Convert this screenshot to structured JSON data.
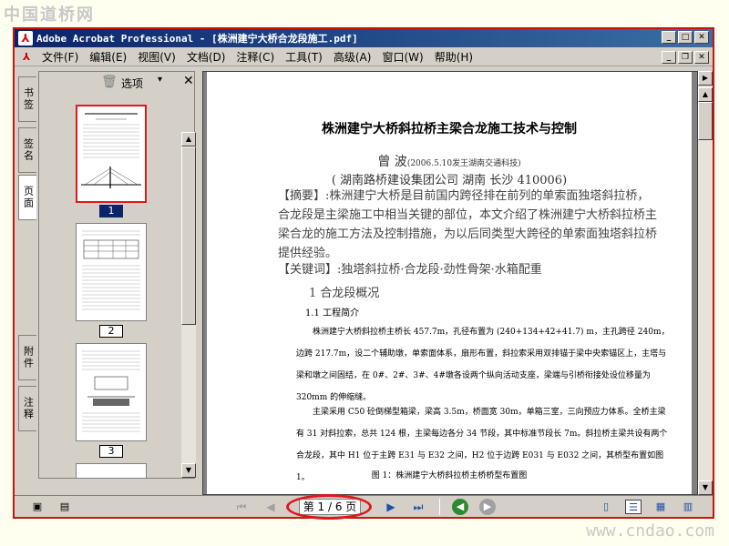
{
  "watermark_top": "中国道桥网",
  "watermark_bottom": "www.cndao.com",
  "window": {
    "title": "Adobe Acrobat Professional - [株洲建宁大桥合龙段施工.pdf]"
  },
  "menu": {
    "items": [
      "文件(F)",
      "编辑(E)",
      "视图(V)",
      "文档(D)",
      "注释(C)",
      "工具(T)",
      "高级(A)",
      "窗口(W)",
      "帮助(H)"
    ]
  },
  "nav_tabs": [
    "书签",
    "签名",
    "页面",
    "附件",
    "注释"
  ],
  "panel": {
    "options_label": "选项",
    "thumb_labels": [
      "1",
      "2",
      "3"
    ]
  },
  "doc": {
    "title": "株洲建宁大桥斜拉桥主梁合龙施工技术与控制",
    "author": "曾  波",
    "author_note": "(2006.5.10发王湖南交通科技)",
    "affiliation": "( 湖南路桥建设集团公司   湖南 长沙  410006)",
    "abstract": "【摘要】:株洲建宁大桥是目前国内跨径排在前列的单索面独塔斜拉桥，合龙段是主梁施工中相当关键的部位，本文介绍了株洲建宁大桥斜拉桥主梁合龙的施工方法及控制措施，为以后同类型大跨径的单索面独塔斜拉桥提供经验。",
    "keywords": "【关键词】:独塔斜拉桥·合龙段·劲性骨架·水箱配重",
    "section1": "1   合龙段概况",
    "section11": "1.1  工程简介",
    "para1": "株洲建宁大桥斜拉桥主桥长 457.7m，孔径布置为 (240+134+42+41.7) m，主孔跨径 240m，边跨 217.7m，设二个辅助墩，单索面体系，扇形布置，斜拉索采用双排锚于梁中央索锚区上，主塔与梁和墩之间固结，在 0#、2#、3#、4#墩各设两个纵向活动支座，梁端与引桥衔接处设位移量为 320mm 的伸缩缝。",
    "para2": "主梁采用 C50 砼倒梯型箱梁，梁高 3.5m，桥面宽 30m，单箱三室，三向预应力体系。全桥主梁有 31 对斜拉索，总共 124 根，主梁每边各分 34 节段，其中标准节段长 7m。斜拉桥主梁共设有两个合龙段，其中 H1 位于主跨 E31 与 E32 之间，H2 位于边跨 E031 与 E032 之间，其桥型布置如图 1。",
    "figure_caption": "图 1：株洲建宁大桥斜拉桥主桥桥型布置图"
  },
  "status": {
    "page_display": "第 1 / 6 页"
  }
}
